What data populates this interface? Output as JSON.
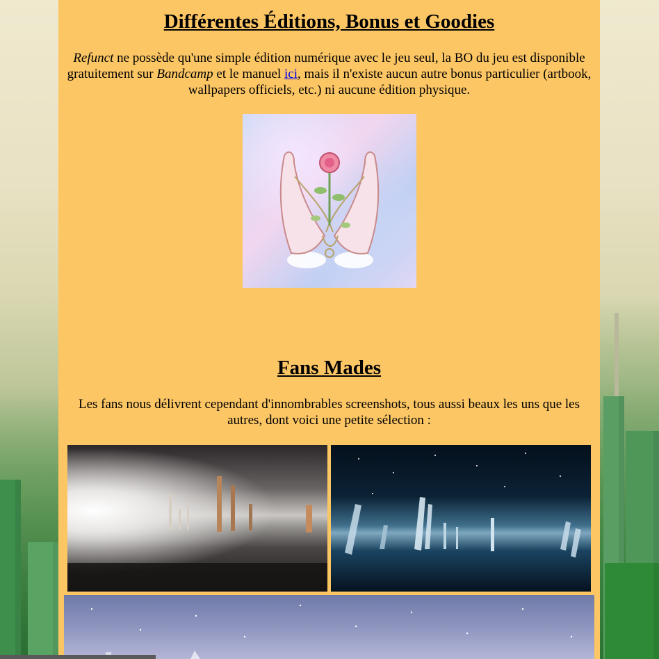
{
  "section1": {
    "title": "Différentes Éditions, Bonus et Goodies",
    "paragraph": {
      "game_name": "Refunct",
      "text_a": " ne possède qu'une simple édition numérique avec le jeu seul, la BO du jeu est disponible gratuitement sur ",
      "bandcamp": "Bandcamp",
      "text_b": " et le manuel ",
      "link_label": "ici",
      "text_c": ", mais il n'existe aucun autre bonus particulier (artbook, wallpapers officiels, etc.) ni aucune édition physique."
    }
  },
  "section2": {
    "title": "Fans Mades",
    "paragraph": "Les fans nous délivrent cependant d'innombrables screenshots, tous aussi beaux les uns que les autres, dont voici une petite sélection :"
  },
  "colors": {
    "content_background": "#fcc665",
    "link": "#0000ee"
  }
}
